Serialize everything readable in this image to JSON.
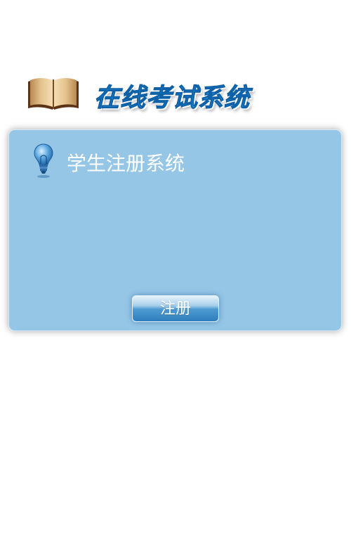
{
  "header": {
    "title": "在线考试系统",
    "logo_icon": "open-book-icon"
  },
  "panel": {
    "icon": "lightbulb-icon",
    "title": "学生注册系统",
    "register_label": "注册"
  },
  "colors": {
    "panel_bg": "#95c6e6",
    "title_blue": "#2b8fd6",
    "button_blue": "#2f7fbd"
  }
}
